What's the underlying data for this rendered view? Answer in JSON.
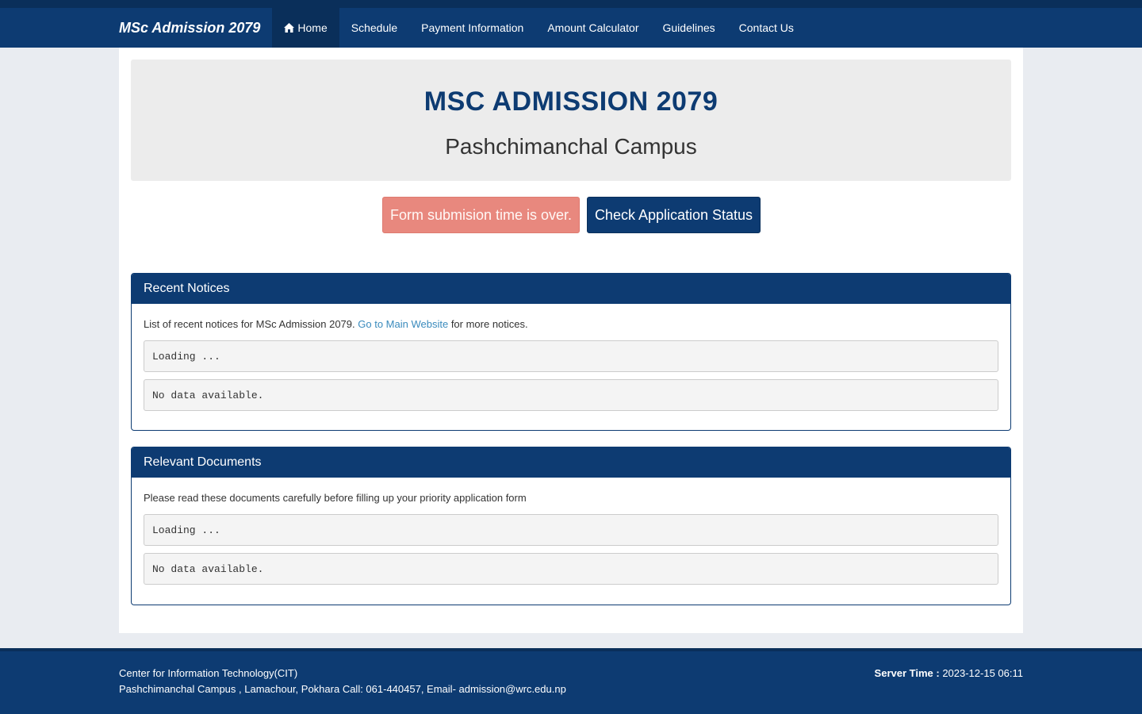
{
  "nav": {
    "brand": "MSc Admission 2079",
    "items": [
      {
        "label": "Home",
        "icon": "home-icon",
        "active": true
      },
      {
        "label": "Schedule"
      },
      {
        "label": "Payment Information"
      },
      {
        "label": "Amount Calculator"
      },
      {
        "label": "Guidelines"
      },
      {
        "label": "Contact Us"
      }
    ]
  },
  "hero": {
    "title": "MSC ADMISSION 2079",
    "subtitle": "Pashchimanchal Campus"
  },
  "actions": {
    "form_over": "Form submision time is over.",
    "check_status": "Check Application Status"
  },
  "notices": {
    "heading": "Recent Notices",
    "text_before": "List of recent notices for MSc Admission 2079.",
    "link": "Go to Main Website",
    "text_after": "for more notices.",
    "loading": "Loading ...",
    "empty": "No data available."
  },
  "documents": {
    "heading": "Relevant Documents",
    "text": "Please read these documents carefully before filling up your priority application form",
    "loading": "Loading ...",
    "empty": "No data available."
  },
  "footer": {
    "org": "Center for Information Technology(CIT)",
    "address": "Pashchimanchal Campus , Lamachour, Pokhara Call: 061-440457, Email- admission@wrc.edu.np",
    "server_label": "Server Time :",
    "server_time": "2023-12-15 06:11"
  },
  "colors": {
    "primary": "#0d3b72",
    "primary_dark": "#0a2f5a",
    "danger_light": "#e8887e",
    "link": "#3a8bbd"
  }
}
